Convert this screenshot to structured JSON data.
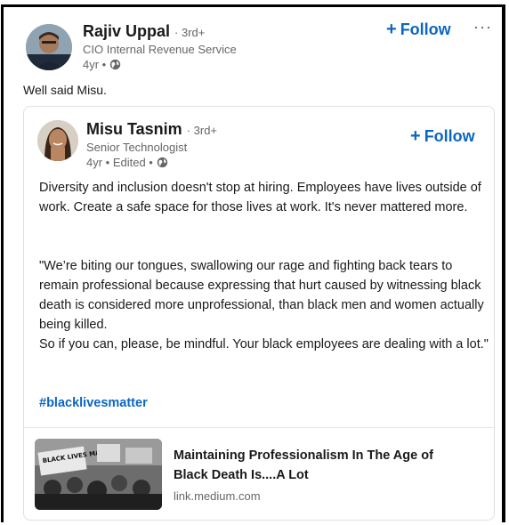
{
  "post": {
    "author": {
      "name": "Rajiv Uppal",
      "degree": "· 3rd+",
      "headline": "CIO Internal Revenue Service",
      "time": "4yr •",
      "follow_label": "Follow",
      "more_label": "···"
    },
    "comment": "Well said Misu."
  },
  "shared": {
    "author": {
      "name": "Misu Tasnim",
      "degree": "· 3rd+",
      "headline": "Senior Technologist",
      "time": "4yr • Edited •",
      "follow_label": "Follow"
    },
    "paragraph1": "Diversity and inclusion doesn't stop at hiring. Employees have lives outside of work. Create a safe space for those lives at work. It's never mattered more.",
    "paragraph2": "\"We’re biting our tongues, swallowing our rage and fighting back tears to remain professional because expressing that hurt caused by witnessing black death is considered more unprofessional, than black men and women actually being killed.",
    "paragraph3": "So if you can, please, be mindful. Your black employees are dealing with a lot.\"",
    "hashtag": "#blacklivesmatter",
    "link": {
      "title": "Maintaining Professionalism In The Age of Black Death Is....A Lot",
      "domain": "link.medium.com",
      "thumbnail_text": "BLACK LIVES MATTER"
    }
  },
  "colors": {
    "accent": "#0a66c2",
    "text": "#191919",
    "muted": "#666666"
  },
  "icons": {
    "follow": "plus-icon",
    "visibility": "globe-icon",
    "more": "ellipsis-icon"
  }
}
